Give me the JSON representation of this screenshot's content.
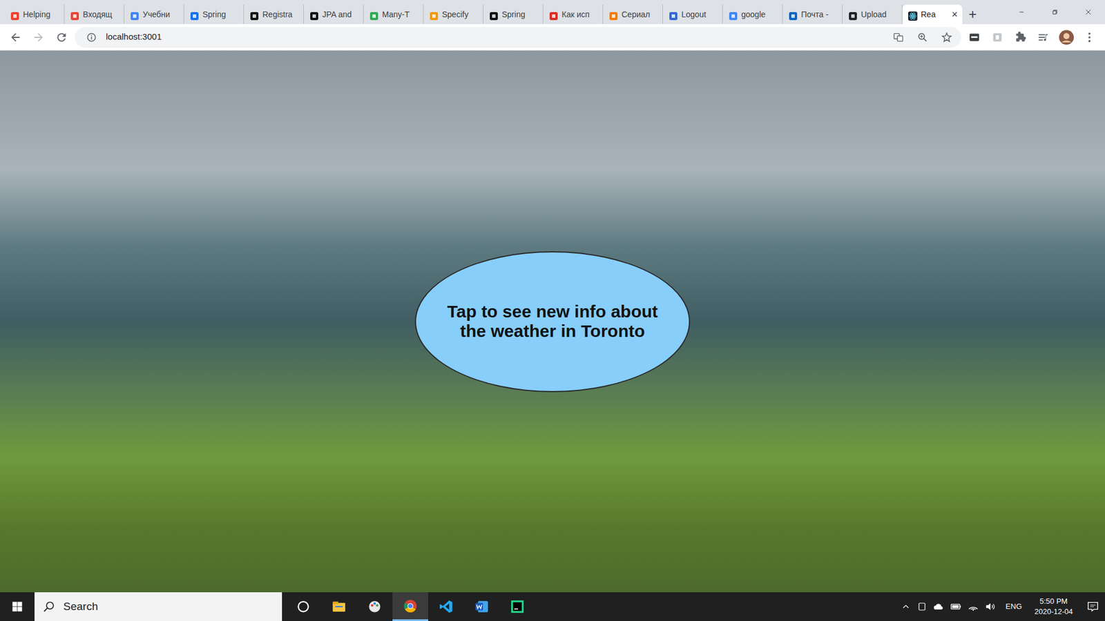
{
  "browser": {
    "tabs": [
      {
        "label": "Helping",
        "selected": false
      },
      {
        "label": "Входящ",
        "selected": false
      },
      {
        "label": "Учебни",
        "selected": false
      },
      {
        "label": "Spring",
        "selected": false
      },
      {
        "label": "Registra",
        "selected": false
      },
      {
        "label": "JPA and",
        "selected": false
      },
      {
        "label": "Many-T",
        "selected": false
      },
      {
        "label": "Specify",
        "selected": false
      },
      {
        "label": "Spring",
        "selected": false
      },
      {
        "label": "Как исп",
        "selected": false
      },
      {
        "label": "Сериал",
        "selected": false
      },
      {
        "label": "Logout",
        "selected": false
      },
      {
        "label": "google",
        "selected": false
      },
      {
        "label": "Почта -",
        "selected": false
      },
      {
        "label": "Upload",
        "selected": false
      },
      {
        "label": "Rea",
        "selected": true
      }
    ],
    "close_tab": "×",
    "new_tab": "+",
    "address": "localhost:3001"
  },
  "page": {
    "bubble_text": "Tap to see new info about the weather in Toronto"
  },
  "taskbar": {
    "search": "Search",
    "language": "ENG",
    "time": "5:50 PM",
    "date": "2020-12-04"
  }
}
